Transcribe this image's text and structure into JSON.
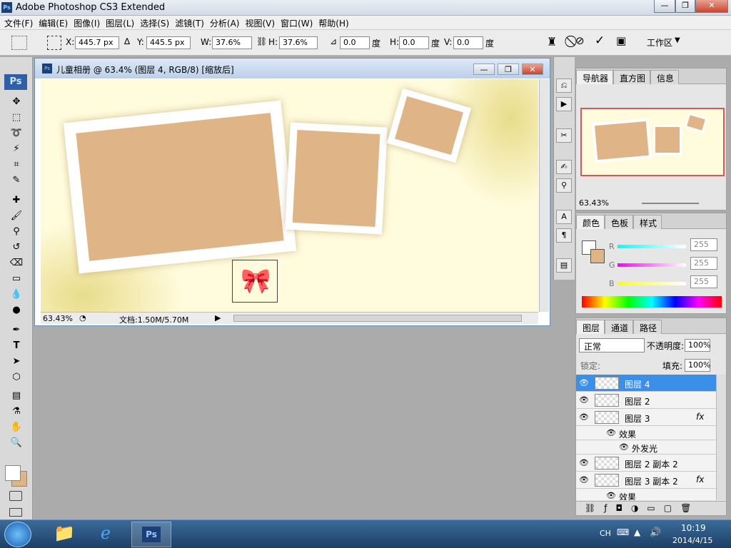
{
  "app": {
    "title": "Adobe Photoshop CS3 Extended",
    "logo": "Ps"
  },
  "window_controls": {
    "minimize": "—",
    "maximize": "❐",
    "close": "✕"
  },
  "menu": [
    "文件(F)",
    "编辑(E)",
    "图像(I)",
    "图层(L)",
    "选择(S)",
    "滤镜(T)",
    "分析(A)",
    "视图(V)",
    "窗口(W)",
    "帮助(H)"
  ],
  "options": {
    "x_label": "X:",
    "x_value": "445.7 px",
    "y_label": "Y:",
    "y_value": "445.5 px",
    "w_label": "W:",
    "w_value": "37.6%",
    "h_label": "H:",
    "h_value": "37.6%",
    "angle_value": "0.0",
    "angle_unit": "度",
    "hskew_label": "H:",
    "hskew_value": "0.0",
    "hskew_unit": "度",
    "vskew_label": "V:",
    "vskew_value": "0.0",
    "vskew_unit": "度",
    "workspace": "工作区"
  },
  "document": {
    "title": "儿童相册 @ 63.4% (图层 4, RGB/8) [缩放后]",
    "zoom": "63.43%",
    "doc_info": "文档:1.50M/5.70M",
    "colors": {
      "canvas_bg": "#fffbdc",
      "photo_fill": "#dfb487"
    }
  },
  "navigator": {
    "tabs": [
      "导航器",
      "直方图",
      "信息"
    ],
    "zoom": "63.43%"
  },
  "color_panel": {
    "tabs": [
      "颜色",
      "色板",
      "样式"
    ],
    "r_label": "R",
    "r_value": "255",
    "g_label": "G",
    "g_value": "255",
    "b_label": "B",
    "b_value": "255"
  },
  "layers_panel": {
    "tabs": [
      "图层",
      "通道",
      "路径"
    ],
    "blend_mode": "正常",
    "opacity_label": "不透明度:",
    "opacity": "100%",
    "lock_label": "锁定:",
    "fill_label": "填充:",
    "fill": "100%",
    "layers": [
      {
        "name": "图层 4",
        "selected": true
      },
      {
        "name": "图层 2"
      },
      {
        "name": "图层 3",
        "fx": "fx"
      },
      {
        "name": "效果",
        "sub": true
      },
      {
        "name": "外发光",
        "sub2": true
      },
      {
        "name": "图层 2 副本 2"
      },
      {
        "name": "图层 3 副本 2",
        "fx": "fx"
      },
      {
        "name": "效果",
        "sub": true
      }
    ]
  },
  "taskbar": {
    "lang": "CH",
    "time": "10:19",
    "date": "2014/4/15"
  }
}
